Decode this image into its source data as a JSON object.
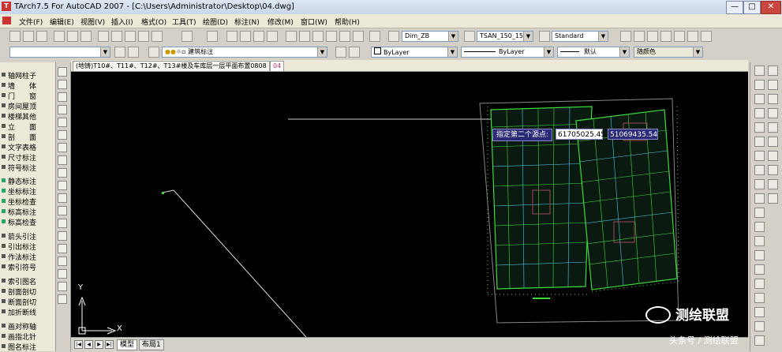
{
  "window": {
    "title": "TArch7.5 For AutoCAD 2007 - [C:\\Users\\Administrator\\Desktop\\04.dwg]",
    "app_icon": "T",
    "minimize": "—",
    "maximize": "□",
    "close": "✕"
  },
  "menu": [
    "文件(F)",
    "编辑(E)",
    "视图(V)",
    "插入(I)",
    "格式(O)",
    "工具(T)",
    "绘图(D)",
    "标注(N)",
    "修改(M)",
    "窗口(W)",
    "帮助(H)"
  ],
  "toolbar": {
    "dim_style": "Dim_ZB",
    "text_style": "TSAN_150_150",
    "table_style": "Standard",
    "layer_name": "建筑标注",
    "color": "ByLayer",
    "linetype": "ByLayer",
    "lineweight": "默认",
    "plot_style": "随颜色"
  },
  "doc_tabs": [
    "(地铸)T10#、T11#、T12#、T13#楼及车库层一层平面布置0808",
    "04"
  ],
  "left_panel": [
    "轴网柱子",
    "墙　　体",
    "门　　窗",
    "房间屋顶",
    "楼梯其他",
    "立　　面",
    "剖　　面",
    "文字表格",
    "尺寸标注",
    "符号标注",
    "静态标注",
    "坐标标注",
    "坐标检查",
    "标高标注",
    "标高检查",
    "箭头引注",
    "引出标注",
    "作法标注",
    "索引符号",
    "索引图名",
    "剖面剖切",
    "断面剖切",
    "加折断线",
    "画对称轴",
    "画指北针",
    "图名标注"
  ],
  "prompt": {
    "label": "指定第二个源点:",
    "x": "61705025.45",
    "y": "51069435.54"
  },
  "axis": {
    "x": "X",
    "y": "Y"
  },
  "layout_tabs": [
    "模型",
    "布局1"
  ],
  "layout_nav": [
    "|◀",
    "◀",
    "▶",
    "▶|"
  ],
  "watermark": "测绘联盟",
  "source": "头条号 / 测绘联盟",
  "colors": {
    "canvas": "#000000",
    "drawing_green": "#3cdc3c",
    "drawing_cyan": "#4ec8e8",
    "prompt_bg": "#2a2a78"
  }
}
